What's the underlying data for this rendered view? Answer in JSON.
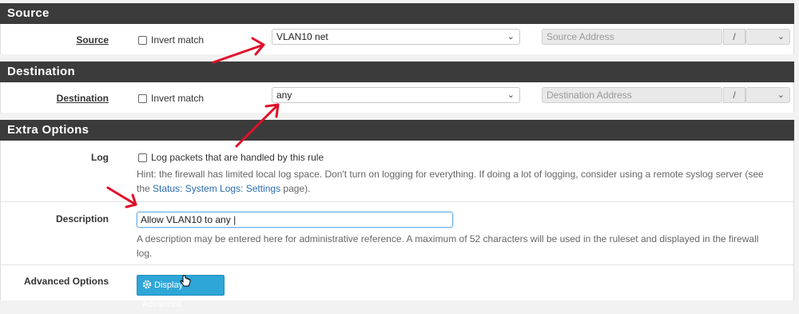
{
  "source_section": {
    "header": "Source",
    "label": "Source",
    "invert_label": "Invert match",
    "select_value": "VLAN10 net",
    "address_placeholder": "Source Address",
    "slash": "/"
  },
  "destination_section": {
    "header": "Destination",
    "label": "Destination",
    "invert_label": "Invert match",
    "select_value": "any",
    "address_placeholder": "Destination Address",
    "slash": "/"
  },
  "extra_section": {
    "header": "Extra Options",
    "log": {
      "label": "Log",
      "checkbox_label": "Log packets that are handled by this rule",
      "hint_pre": "Hint: the firewall has limited local log space. Don't turn on logging for everything. If doing a lot of logging, consider using a remote syslog server (see",
      "hint_the": "the ",
      "hint_link": "Status: System Logs: Settings",
      "hint_post": " page)."
    },
    "description": {
      "label": "Description",
      "value": "Allow VLAN10 to any |",
      "hint_line1": "A description may be entered here for administrative reference. A maximum of 52 characters will be used in the ruleset and displayed in the firewall",
      "hint_line2": "log."
    },
    "advanced": {
      "label": "Advanced Options",
      "button_label": "Display Advanced"
    }
  },
  "colors": {
    "header_bg": "#3b3b3b",
    "button_bg": "#2ea6d8",
    "arrow": "#e0102a",
    "link": "#2b6cb0"
  },
  "icons": [
    "chevron-down-icon",
    "gear-icon",
    "hand-cursor-icon",
    "red-arrow-annotation"
  ]
}
